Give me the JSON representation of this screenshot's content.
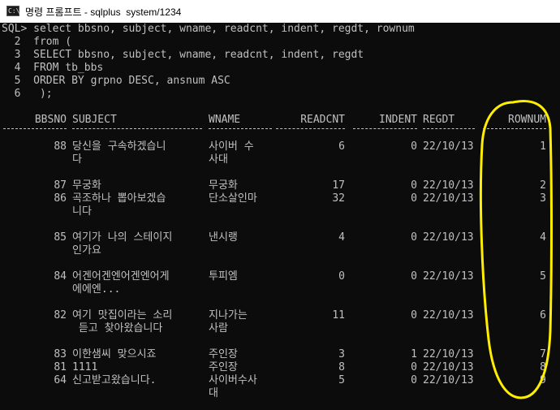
{
  "window": {
    "title": "명령 프롬프트 - sqlplus  system/1234",
    "icon": "cmd-console-icon",
    "icon_text": "C:\\"
  },
  "query_lines": [
    "SQL> select bbsno, subject, wname, readcnt, indent, regdt, rownum",
    "  2  from (",
    "  3  SELECT bbsno, subject, wname, readcnt, indent, regdt",
    "  4  FROM tb_bbs",
    "  5  ORDER BY grpno DESC, ansnum ASC",
    "  6   );"
  ],
  "headers": {
    "bbsno": "BBSNO",
    "subject": "SUBJECT",
    "wname": "WNAME",
    "readcnt": "READCNT",
    "indent": "INDENT",
    "regdt": "REGDT",
    "rownum": "ROWNUM"
  },
  "rows": [
    {
      "bbsno": "88",
      "subject": [
        "당신을 구속하겠습니",
        "다"
      ],
      "wname": [
        "사이버 수",
        "사대"
      ],
      "readcnt": "6",
      "indent": "0",
      "regdt": "22/10/13",
      "rownum": "1"
    },
    {
      "bbsno": "87",
      "subject": [
        "무궁화"
      ],
      "wname": [
        "무궁화"
      ],
      "readcnt": "17",
      "indent": "0",
      "regdt": "22/10/13",
      "rownum": "2"
    },
    {
      "bbsno": "86",
      "subject": [
        "곡조하나 뽑아보겠습",
        "니다"
      ],
      "wname": [
        "단소살인마"
      ],
      "readcnt": "32",
      "indent": "0",
      "regdt": "22/10/13",
      "rownum": "3"
    },
    {
      "bbsno": "85",
      "subject": [
        "여기가 나의 스테이지",
        "인가요"
      ],
      "wname": [
        "낸시랭"
      ],
      "readcnt": "4",
      "indent": "0",
      "regdt": "22/10/13",
      "rownum": "4"
    },
    {
      "bbsno": "84",
      "subject": [
        "어겐어겐엔어겐엔어게",
        "에에엔..."
      ],
      "wname": [
        "투피엠"
      ],
      "readcnt": "0",
      "indent": "0",
      "regdt": "22/10/13",
      "rownum": "5"
    },
    {
      "bbsno": "82",
      "subject": [
        "여기 맛집이라는 소리",
        " 듣고 찾아왔습니다"
      ],
      "wname": [
        "지나가는",
        "사람"
      ],
      "readcnt": "11",
      "indent": "0",
      "regdt": "22/10/13",
      "rownum": "6"
    },
    {
      "bbsno": "83",
      "subject": [
        "이한샘씨 맞으시죠"
      ],
      "wname": [
        "주인장"
      ],
      "readcnt": "3",
      "indent": "1",
      "regdt": "22/10/13",
      "rownum": "7"
    },
    {
      "bbsno": "81",
      "subject": [
        "1111"
      ],
      "wname": [
        "주인장"
      ],
      "readcnt": "8",
      "indent": "0",
      "regdt": "22/10/13",
      "rownum": "8"
    },
    {
      "bbsno": "64",
      "subject": [
        "신고받고왔습니다."
      ],
      "wname": [
        "사이버수사",
        "대"
      ],
      "readcnt": "5",
      "indent": "0",
      "regdt": "22/10/13",
      "rownum": "9"
    }
  ],
  "colors": {
    "background": "#0c0c0c",
    "text": "#c0c0c0",
    "annotation": "#ffee00",
    "titlebar": "#ffffff"
  }
}
